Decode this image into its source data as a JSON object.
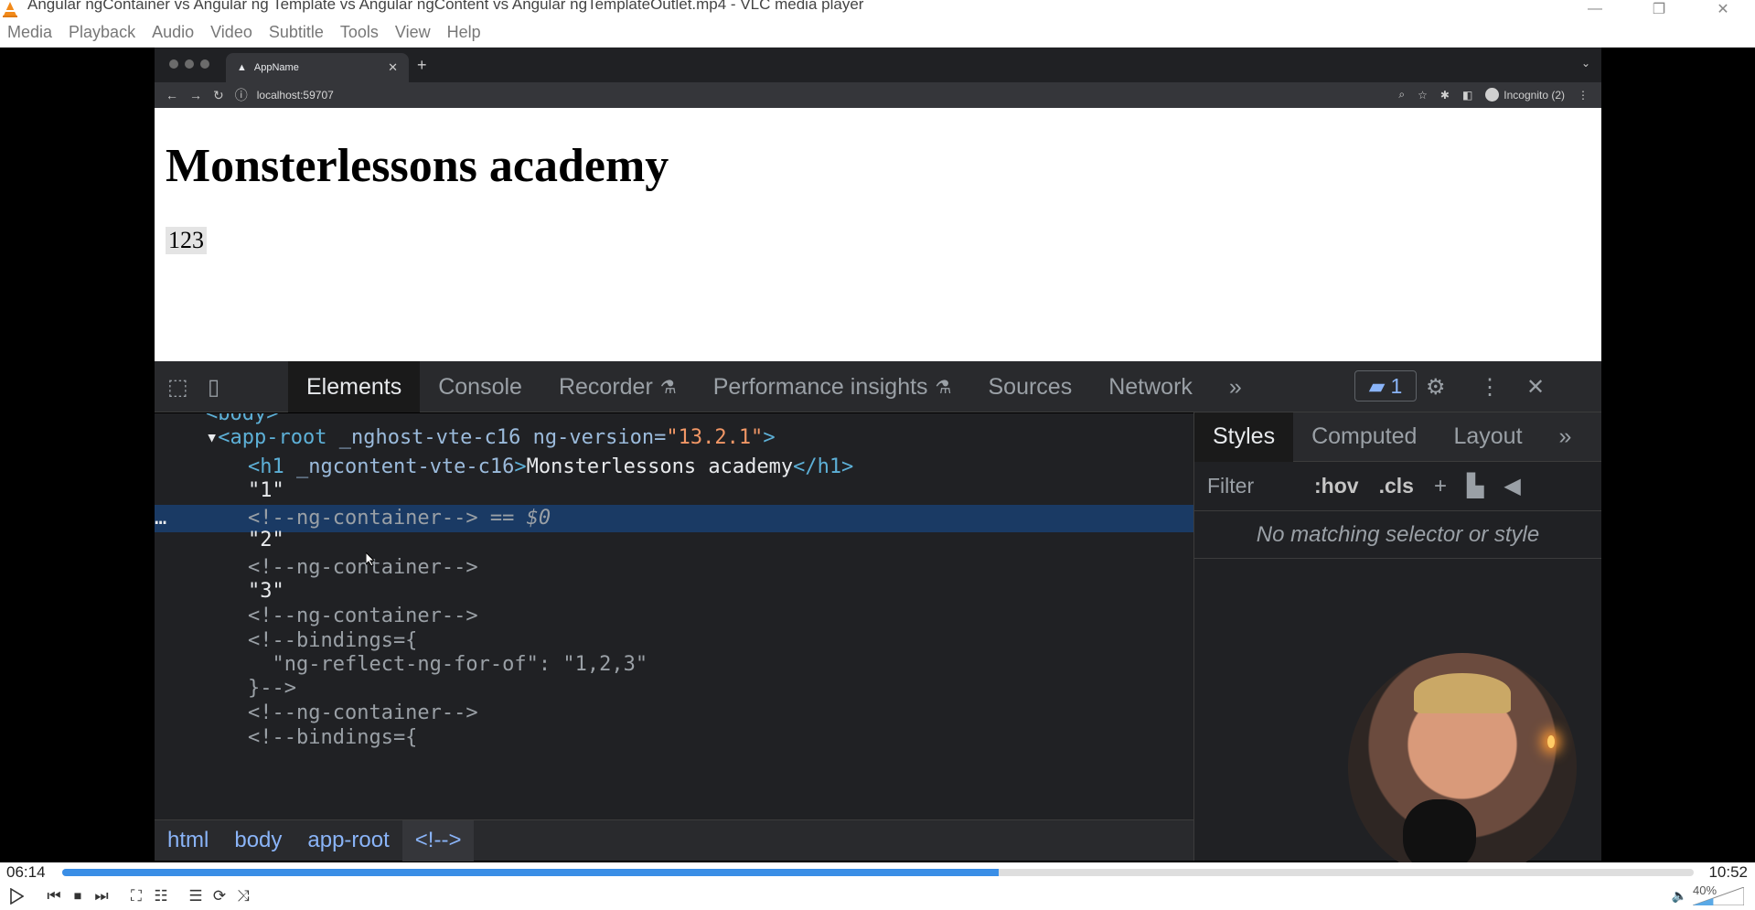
{
  "window": {
    "title": "Angular ngContainer vs Angular ng Template vs Angular ngContent vs Angular ngTemplateOutlet.mp4 - VLC media player",
    "buttons": [
      "—",
      "❐",
      "✕"
    ]
  },
  "menubar": [
    "Media",
    "Playback",
    "Audio",
    "Video",
    "Subtitle",
    "Tools",
    "View",
    "Help"
  ],
  "browser": {
    "tab_label": "AppName",
    "tab_close": "✕",
    "new_tab": "+",
    "url": "localhost:59707",
    "profile_label": "Incognito (2)"
  },
  "page": {
    "heading": "Monsterlessons academy",
    "numbers": "123"
  },
  "devtools": {
    "tabs": [
      {
        "label": "Elements"
      },
      {
        "label": "Console"
      },
      {
        "label": "Recorder"
      },
      {
        "label": "Performance insights"
      },
      {
        "label": "Sources"
      },
      {
        "label": "Network"
      }
    ],
    "more_tabs": "»",
    "issues_count": "1",
    "dom_lines": {
      "body_partial": "<body>",
      "app_root_open_tag": "<app-root",
      "app_root_attr": " _nghost-vte-c16 ng-version=",
      "app_root_val": "\"13.2.1\"",
      "app_root_close": ">",
      "h1_open": "<h1",
      "h1_attr": " _ngcontent-vte-c16",
      "h1_gt": ">",
      "h1_text": "Monsterlessons academy",
      "h1_close": "</h1>",
      "text_1": "\"1\"",
      "selected_comment": "<!--ng-container-->",
      "selected_suffix": " == $0",
      "text_2": "\"2\"",
      "comment_2": "<!--ng-container-->",
      "text_3": "\"3\"",
      "comment_3": "<!--ng-container-->",
      "bindings_open": "<!--bindings={",
      "bindings_body": "  \"ng-reflect-ng-for-of\": \"1,2,3\"",
      "bindings_close": "}-->",
      "comment_4": "<!--ng-container-->",
      "bindings_open_2": "<!--bindings={",
      "ellipsis": "…"
    },
    "breadcrumbs": [
      "html",
      "body",
      "app-root",
      "<!-->"
    ],
    "styles_pane": {
      "tabs": [
        "Styles",
        "Computed",
        "Layout"
      ],
      "more": "»",
      "filter_placeholder": "Filter",
      "hov": ":hov",
      "cls": ".cls",
      "empty_message": "No matching selector or style"
    }
  },
  "player": {
    "elapsed": "06:14",
    "total": "10:52",
    "progress": 0.574,
    "volume": "40%"
  },
  "colors": {
    "progress_fill": "#3a8ee6",
    "devtools_bg": "#202124",
    "selected_row": "#1a3a64"
  }
}
